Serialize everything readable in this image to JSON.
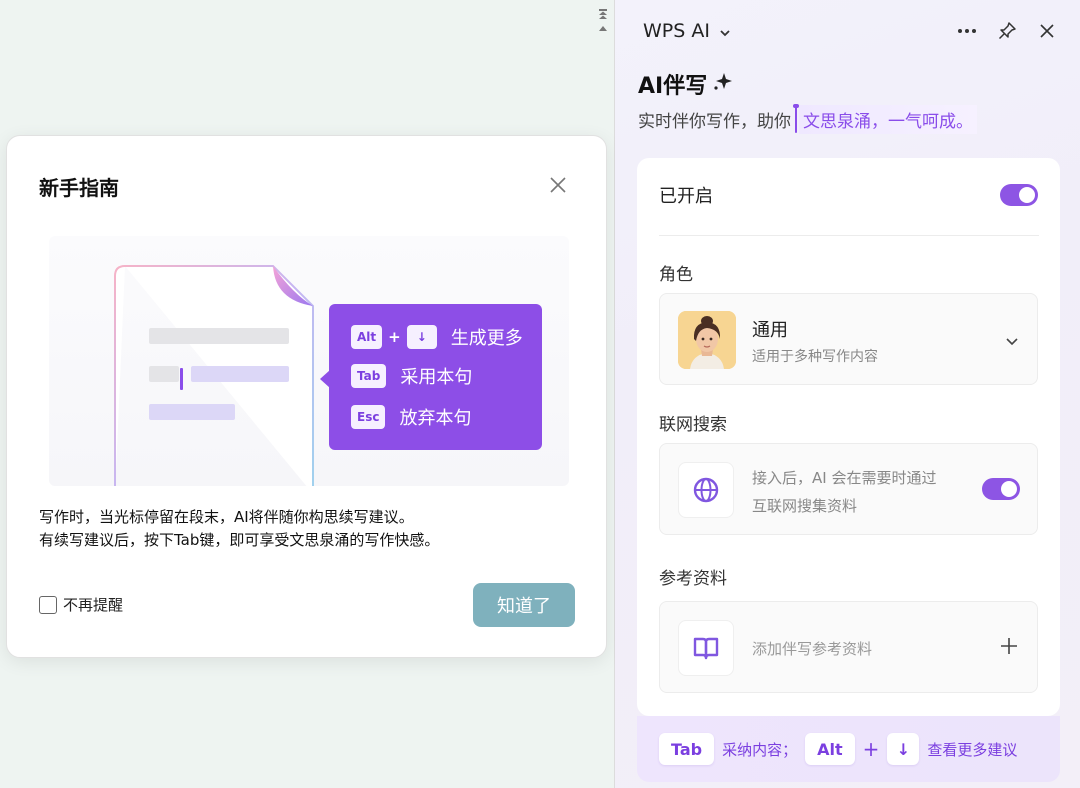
{
  "guide": {
    "title": "新手指南",
    "shortcuts": [
      {
        "keys": [
          "Alt",
          "↓"
        ],
        "joiner": "+",
        "label": "生成更多"
      },
      {
        "keys": [
          "Tab"
        ],
        "label": "采用本句"
      },
      {
        "keys": [
          "Esc"
        ],
        "label": "放弃本句"
      }
    ],
    "description_line1": "写作时，当光标停留在段末，AI将伴随你构思续写建议。",
    "description_line2": "有续写建议后，按下Tab键，即可享受文思泉涌的写作快感。",
    "dont_remind_label": "不再提醒",
    "got_it_label": "知道了"
  },
  "panel": {
    "title": "WPS AI",
    "feature_title": "AI伴写",
    "subtitle_plain": "实时伴你写作，助你",
    "subtitle_highlight": "文思泉涌，一气呵成。",
    "enabled_label": "已开启",
    "enabled_state": true,
    "role_section_label": "角色",
    "role_name": "通用",
    "role_desc": "适用于多种写作内容",
    "web_search_section_label": "联网搜索",
    "web_search_desc_line1": "接入后，AI 会在需要时通过",
    "web_search_desc_line2": "互联网搜集资料",
    "web_search_state": true,
    "reference_section_label": "参考资料",
    "reference_add_label": "添加伴写参考资料",
    "footer": {
      "key_tab": "Tab",
      "accept_label": "采纳内容；",
      "key_alt": "Alt",
      "plus": "+",
      "key_down": "↓",
      "more_label": "查看更多建议"
    }
  },
  "colors": {
    "accent": "#8d4ee7",
    "toggle_on": "#8d55e4",
    "got_it_button": "#7fb1bd",
    "doc_background": "#eef4f1"
  },
  "icons": [
    "scroll-top-icon",
    "scroll-up-icon",
    "close-icon",
    "chevron-down-icon",
    "more-icon",
    "pin-icon",
    "sparkle-icon",
    "globe-icon",
    "book-icon",
    "plus-icon"
  ]
}
